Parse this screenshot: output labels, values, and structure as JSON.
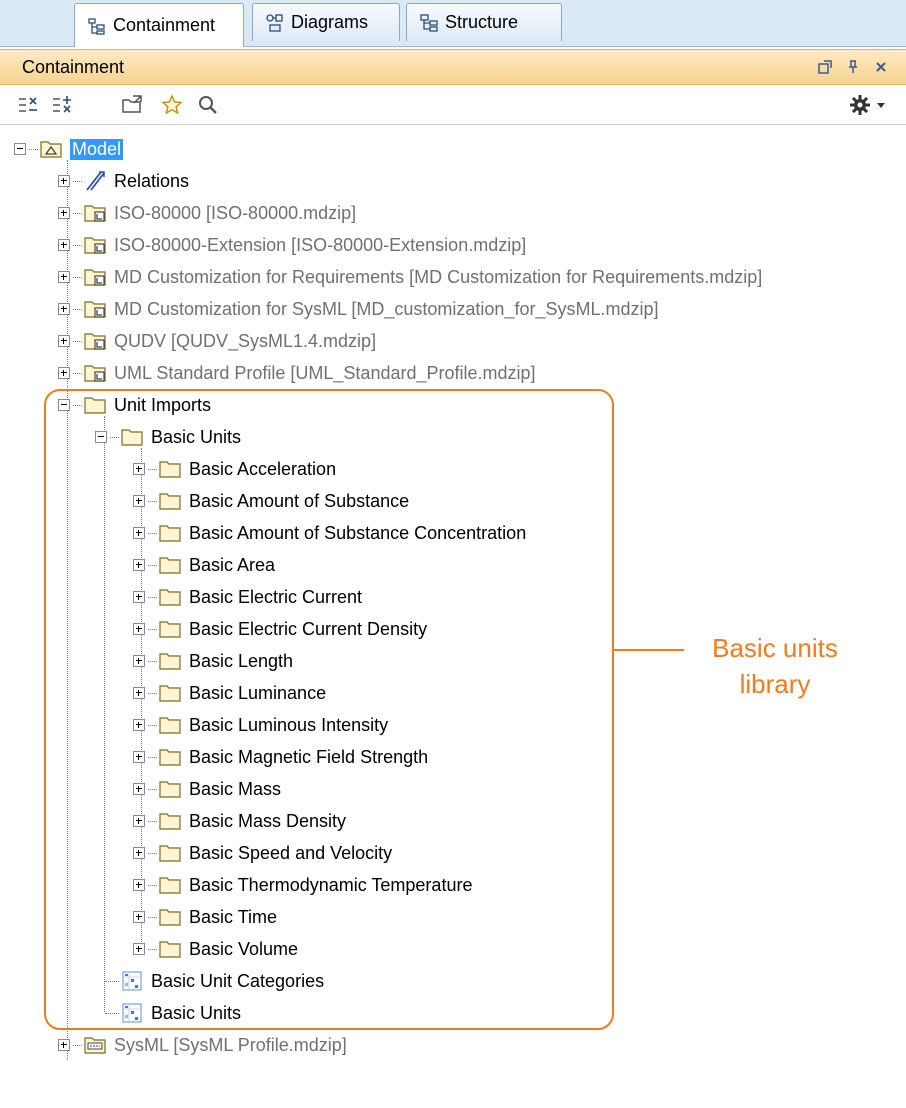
{
  "tabs": [
    {
      "label": "Containment",
      "icon": "containment-tree-icon",
      "active": true
    },
    {
      "label": "Diagrams",
      "icon": "diagrams-icon",
      "active": false
    },
    {
      "label": "Structure",
      "icon": "structure-icon",
      "active": false
    }
  ],
  "panel": {
    "title": "Containment"
  },
  "toolbar_icons": [
    "collapse-all-icon",
    "expand-all-icon",
    "open-project-icon",
    "favorites-star-icon",
    "search-icon",
    "settings-gear-icon",
    "dropdown-arrow-icon"
  ],
  "tree": {
    "root": {
      "label": "Model"
    },
    "items": [
      {
        "label": "Relations"
      },
      {
        "label": "ISO-80000 [ISO-80000.mdzip]"
      },
      {
        "label": "ISO-80000-Extension [ISO-80000-Extension.mdzip]"
      },
      {
        "label": "MD Customization for Requirements [MD Customization for Requirements.mdzip]"
      },
      {
        "label": "MD Customization for SysML [MD_customization_for_SysML.mdzip]"
      },
      {
        "label": "QUDV [QUDV_SysML1.4.mdzip]"
      },
      {
        "label": "UML Standard Profile [UML_Standard_Profile.mdzip]"
      },
      {
        "label": "Unit Imports"
      },
      {
        "label": "Basic Units"
      },
      {
        "label": "Basic Acceleration"
      },
      {
        "label": "Basic Amount of Substance"
      },
      {
        "label": "Basic Amount of Substance Concentration"
      },
      {
        "label": "Basic Area"
      },
      {
        "label": "Basic Electric Current"
      },
      {
        "label": "Basic Electric Current Density"
      },
      {
        "label": "Basic Length"
      },
      {
        "label": "Basic Luminance"
      },
      {
        "label": "Basic Luminous Intensity"
      },
      {
        "label": "Basic Magnetic Field Strength"
      },
      {
        "label": "Basic Mass"
      },
      {
        "label": "Basic Mass Density"
      },
      {
        "label": "Basic Speed and Velocity"
      },
      {
        "label": "Basic Thermodynamic Temperature"
      },
      {
        "label": "Basic Time"
      },
      {
        "label": "Basic Volume"
      },
      {
        "label": "Basic Unit Categories"
      },
      {
        "label": "Basic Units"
      },
      {
        "label": "SysML [SysML Profile.mdzip]"
      }
    ]
  },
  "callout": {
    "line1": "Basic units",
    "line2": "library",
    "color": "#f07c1e"
  }
}
